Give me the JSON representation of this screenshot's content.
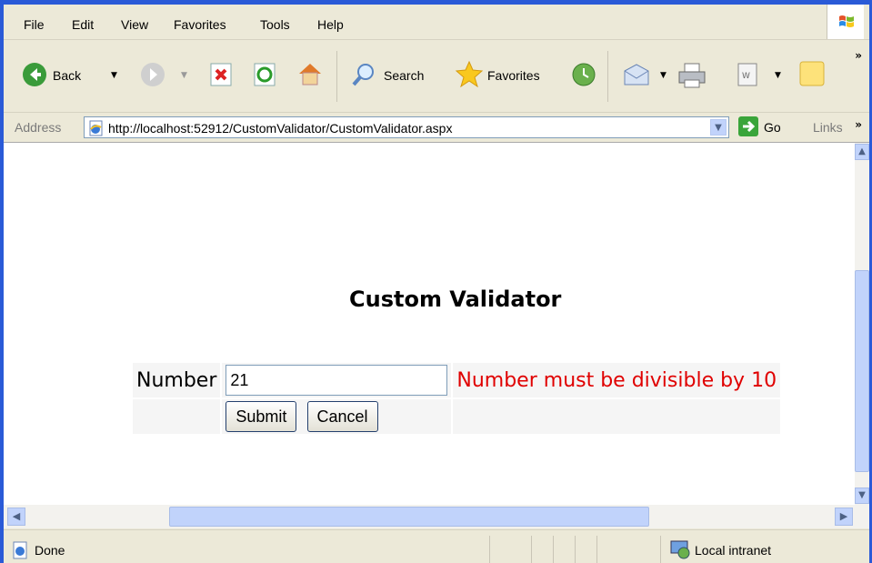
{
  "menu": [
    "File",
    "Edit",
    "View",
    "Favorites",
    "Tools",
    "Help"
  ],
  "toolbar": {
    "back_label": "Back",
    "search_label": "Search",
    "favorites_label": "Favorites"
  },
  "address": {
    "label": "Address",
    "url": "http://localhost:52912/CustomValidator/CustomValidator.aspx",
    "go_label": "Go",
    "links_label": "Links"
  },
  "page": {
    "title": "Custom Validator",
    "number_label": "Number",
    "number_value": "21",
    "error_message": "Number must be divisible by 10",
    "submit_label": "Submit",
    "cancel_label": "Cancel"
  },
  "status": {
    "text": "Done",
    "zone": "Local intranet"
  },
  "colors": {
    "error": "#e00000",
    "chrome": "#ece9d8",
    "scroll_thumb": "#c1d3fb"
  }
}
